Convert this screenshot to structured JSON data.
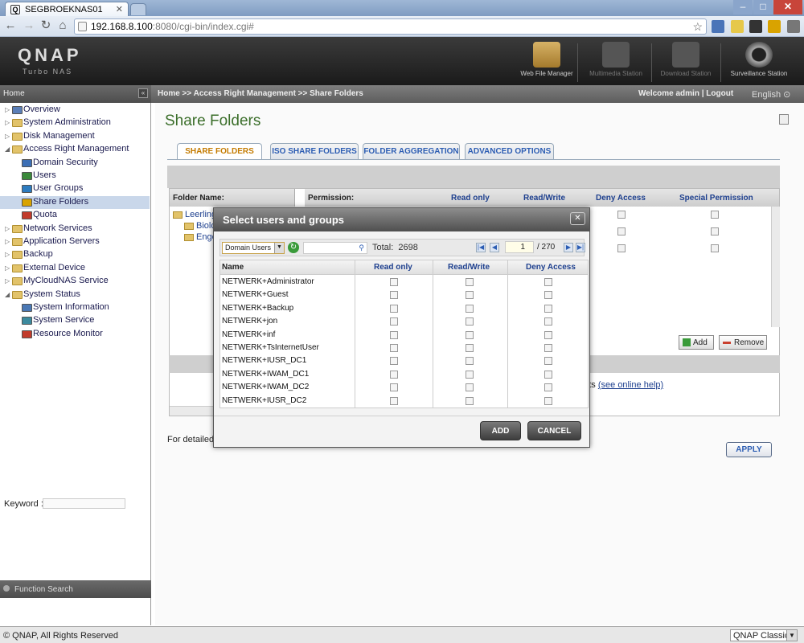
{
  "browser": {
    "tab_title": "SEGBROEKNAS01",
    "url_host": "192.168.8.100",
    "url_rest": ":8080/cgi-bin/index.cgi#"
  },
  "header": {
    "logo": "QNAP",
    "subtitle": "Turbo NAS",
    "stations": [
      {
        "label": "Web File Manager",
        "icon": "folder-magnifier-icon"
      },
      {
        "label": "Multimedia Station",
        "icon": "film-icon"
      },
      {
        "label": "Download Station",
        "icon": "download-icon"
      },
      {
        "label": "Surveillance Station",
        "icon": "camera-icon"
      }
    ]
  },
  "crumbbar": {
    "home": "Home",
    "breadcrumb": "Home >> Access Right Management >> Share Folders",
    "welcome": "Welcome admin | Logout",
    "language": "English"
  },
  "sidebar": {
    "items": [
      {
        "label": "Overview",
        "level": 0,
        "icon": "overview-icon"
      },
      {
        "label": "System Administration",
        "level": 0,
        "icon": "folder-icon"
      },
      {
        "label": "Disk Management",
        "level": 0,
        "icon": "folder-icon"
      },
      {
        "label": "Access Right Management",
        "level": 0,
        "icon": "folder-open-icon"
      },
      {
        "label": "Domain Security",
        "level": 1,
        "icon": "domain-icon"
      },
      {
        "label": "Users",
        "level": 1,
        "icon": "user-icon"
      },
      {
        "label": "User Groups",
        "level": 1,
        "icon": "group-icon"
      },
      {
        "label": "Share Folders",
        "level": 1,
        "icon": "share-folder-icon",
        "selected": true
      },
      {
        "label": "Quota",
        "level": 1,
        "icon": "quota-icon"
      },
      {
        "label": "Network Services",
        "level": 0,
        "icon": "folder-icon"
      },
      {
        "label": "Application Servers",
        "level": 0,
        "icon": "folder-icon"
      },
      {
        "label": "Backup",
        "level": 0,
        "icon": "folder-icon"
      },
      {
        "label": "External Device",
        "level": 0,
        "icon": "folder-icon"
      },
      {
        "label": "MyCloudNAS Service",
        "level": 0,
        "icon": "folder-icon"
      },
      {
        "label": "System Status",
        "level": 0,
        "icon": "folder-open-icon"
      },
      {
        "label": "System Information",
        "level": 1,
        "icon": "info-icon"
      },
      {
        "label": "System Service",
        "level": 1,
        "icon": "service-icon"
      },
      {
        "label": "Resource Monitor",
        "level": 1,
        "icon": "monitor-icon"
      }
    ],
    "function_search": "Function Search",
    "keyword_label": "Keyword :"
  },
  "main": {
    "title": "Share Folders",
    "tabs": [
      "SHARE FOLDERS",
      "ISO SHARE FOLDERS",
      "FOLDER AGGREGATION",
      "ADVANCED OPTIONS"
    ],
    "folder_header": "Folder Name:",
    "perm_headers": [
      "Permission:",
      "Read only",
      "Read/Write",
      "Deny Access",
      "Special Permission"
    ],
    "tree": [
      "Leerling",
      "Biolo",
      "Enge"
    ],
    "add_label": "Add",
    "remove_label": "Remove",
    "ents_text": "ents ",
    "online_help": "(see online help)",
    "detail_text": "For detailed",
    "apply_label": "APPLY"
  },
  "dialog": {
    "title": "Select users and groups",
    "domain_select": "Domain Users",
    "total_label": "Total:",
    "total_value": "2698",
    "page_value": "1",
    "page_count": "/ 270",
    "columns": [
      "Name",
      "Read only",
      "Read/Write",
      "Deny Access"
    ],
    "rows": [
      "NETWERK+Administrator",
      "NETWERK+Guest",
      "NETWERK+Backup",
      "NETWERK+jon",
      "NETWERK+inf",
      "NETWERK+TsInternetUser",
      "NETWERK+IUSR_DC1",
      "NETWERK+IWAM_DC1",
      "NETWERK+IWAM_DC2",
      "NETWERK+IUSR_DC2"
    ],
    "add_label": "ADD",
    "cancel_label": "CANCEL"
  },
  "footer": {
    "copyright": "© QNAP, All Rights Reserved",
    "theme": "QNAP Classic"
  },
  "colors": {
    "title_green": "#3b6e2a",
    "link_blue": "#1d3f8e",
    "active_tab_orange": "#c47b00"
  }
}
